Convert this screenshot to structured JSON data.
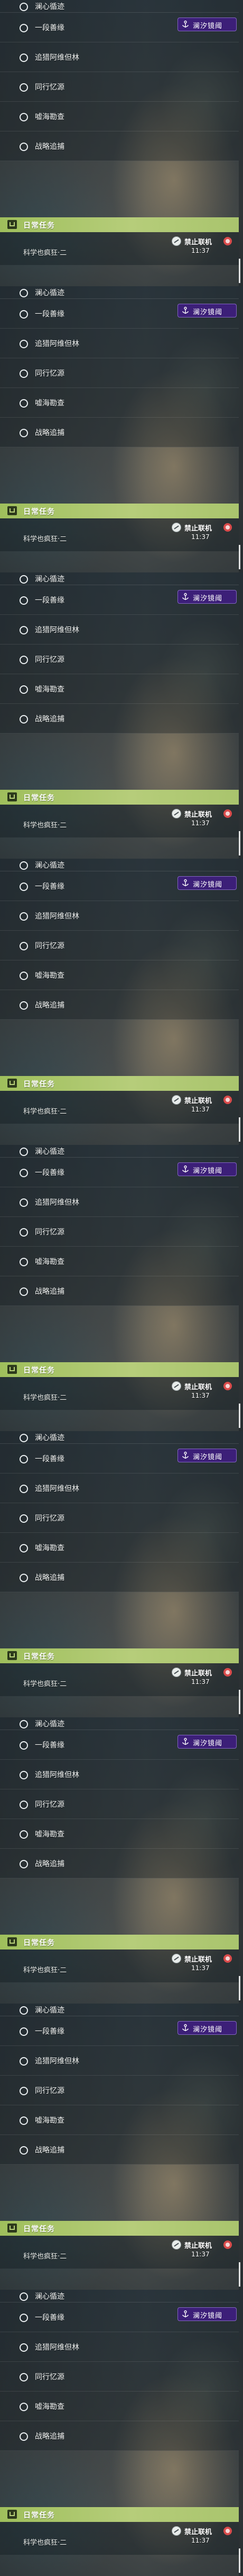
{
  "quests": [
    {
      "label": "澜心循迹"
    },
    {
      "label": "一段善缘"
    },
    {
      "label": "追猎阿维但林"
    },
    {
      "label": "同行忆源"
    },
    {
      "label": "嘘海勘查"
    },
    {
      "label": "战略追捕"
    }
  ],
  "status_badge": {
    "label": "澜汐镜阈",
    "icon": "anchor-icon",
    "color": "#3c1f78"
  },
  "daily": {
    "header_label": "日常任务",
    "header_color": "#a9c46d",
    "task_label": "科学也疯狂·二",
    "time": "11:37",
    "badge_label": "禁止联机",
    "badge_icon": "forbid-icon",
    "alert_icon": "alert-dot-icon"
  },
  "panel_count": 9
}
